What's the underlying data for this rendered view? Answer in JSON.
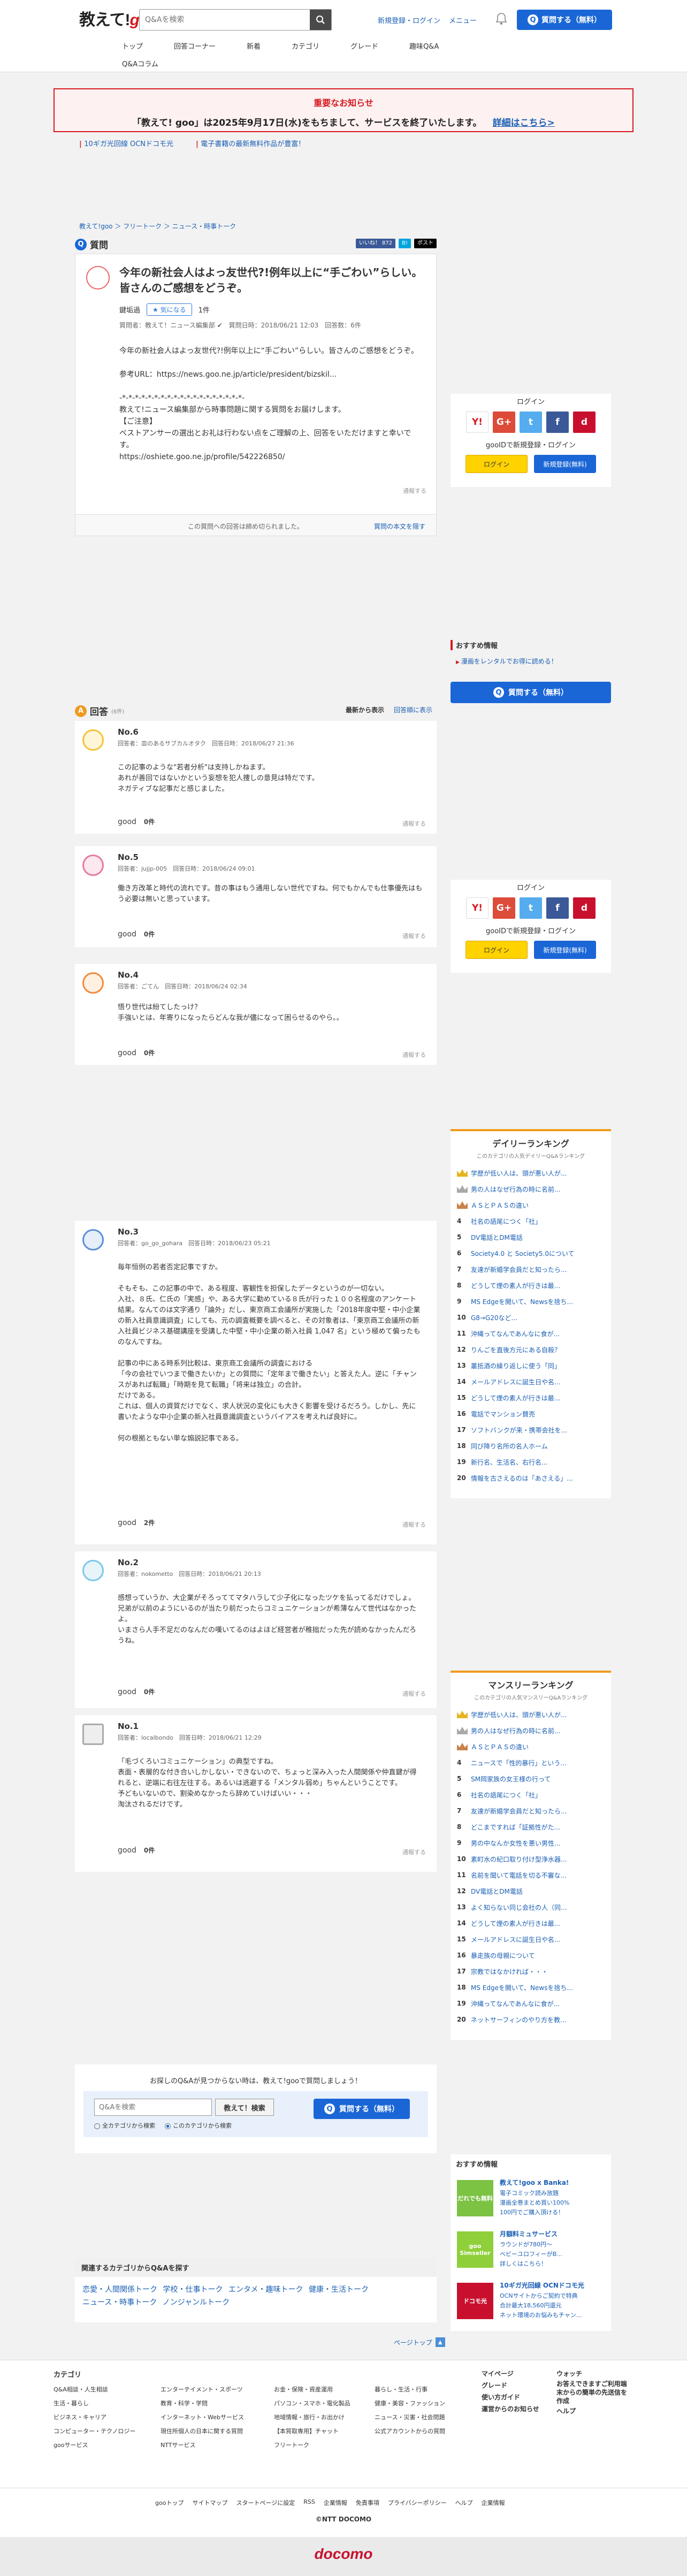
{
  "header": {
    "logo_text": "教えて!",
    "logo_brand": "goo",
    "search_placeholder": "Q&Aを検索",
    "links": [
      "新規登録・ログイン",
      "メニュー"
    ],
    "ask_button": "質問する（無料）",
    "ask_icon_char": "Q"
  },
  "nav": {
    "row1": [
      "トップ",
      "回答コーナー",
      "新着",
      "カテゴリ",
      "グレード",
      "趣味Q&A"
    ],
    "row2": [
      "Q&Aコラム"
    ]
  },
  "notice": {
    "title": "重要なお知らせ",
    "body": "「教えて! goo」は2025年9月17日(水)をもちまして、サービスを終了いたします。",
    "link": "詳細はこちら>"
  },
  "promo_links": [
    "10ギガ光回線 OCNドコモ光",
    "電子書籍の最新無料作品が豊富！"
  ],
  "breadcrumb": "教えて!goo ＞ フリートーク ＞ ニュース・時事トーク",
  "question": {
    "label": "質問",
    "badge_char": "Q",
    "social": [
      "いいね！ 872",
      "B!",
      "ポスト"
    ],
    "title": "今年の新社会人はよっ友世代?!例年以上に“手ごわい”らしい。皆さんのご感想をどうぞ。",
    "author": "鍵垢過",
    "follow_button": "気になる",
    "follow_count": "1件",
    "meta": "質問者：教えて！ニュース編集部 ✔　質問日時：2018/06/21 12:03　回答数：6件",
    "body": "今年の新社会人はよっ友世代?!例年以上に“手ごわい”らしい。皆さんのご感想をどうぞ。\n\n参考URL：https://news.goo.ne.jp/article/president/bizskil...\n\n-*-*-*-*-*-*-*-*-*-*-*-*-*-*-*-*-*-*-*-\n教えて!ニュース編集部から時事問題に関する質問をお届けします。\n【ご注意】\nベストアンサーの選出とお礼は行わない点をご理解の上、回答をいただけますと幸いです。\nhttps://oshiete.goo.ne.jp/profile/542226850/",
    "report": "通報する",
    "footer_text": "この質問への回答は締め切られました。",
    "footer_link": "質問の本文を隠す"
  },
  "login": {
    "title": "ログイン",
    "icons": [
      "Y!",
      "G+",
      "t",
      "f",
      "d"
    ],
    "sub": "gooIDで新規登録・ログイン",
    "login_button": "ログイン",
    "register_button": "新規登録(無料)"
  },
  "recommend": {
    "heading": "おすすめ情報",
    "link": "漫画をレンタルでお得に読める！",
    "ask_button": "質問する（無料）"
  },
  "answers_header": {
    "label": "回答",
    "count": "(6件)",
    "badge_char": "A",
    "sort_label": "最新から表示",
    "sort_link": "回答順に表示"
  },
  "answers": [
    {
      "no": "No.6",
      "meta": "回答者：皿のあるサブカルオタク　回答日時：2018/06/27 21:36",
      "body": "この記事のような\"若者分析\"は支持しかねます。\nあれが善回ではないかという妄想を犯人捜しの意見は特だです。\nネガティブな記事だと感じました。",
      "good_label": "good",
      "good_count": "0件",
      "report": "通報する"
    },
    {
      "no": "No.5",
      "meta": "回答者：jujjp-005　回答日時：2018/06/24 09:01",
      "body": "働き方改革と時代の流れです。昔の事はもう通用しない世代ですね。何でもかんでも仕事優先はもう必要は無いと思っています。",
      "good_label": "good",
      "good_count": "0件",
      "report": "通報する"
    },
    {
      "no": "No.4",
      "meta": "回答者：ごてん　回答日時：2018/06/24 02:34",
      "body": "悟り世代は紛てしたっけ？\n手強いとは、年寄りになったらどんな我が儘になって困らせるのやら。。",
      "good_label": "good",
      "good_count": "0件",
      "report": "通報する"
    },
    {
      "no": "No.3",
      "meta": "回答者：go_go_gohara　回答日時：2018/06/23 05:21",
      "body": "毎年恒例の若者否定記事ですか。\n\nそもそも、この記事の中で、ある程度、客観性を担保したデータというのが一切ない。\n入社、８氏、仁氏の「実感」や、ある大学に勤めている８氏が行った１００名程度のアンケート結果。なんてのは文字通り「論外」だし、東京商工会議所が実施した「2018年度中堅・中小企業の新入社員意識調査」にしても、元の調査概要を調べると、その対象者は、「東京商工会議所の新入社員ビジネス基礎講座を受講した中堅・中小企業の新入社員 1,047 名」という極めて偏ったものなんですね。\n\n記事の中にある時系列比較は、東京商工会議所の調査における\n「今の会社でいつまで働きたいか」との質問に「定年まで働きたい」と答えた人。逆に「チャンスがあれば転職」「時期を見て転職」「将来は独立」の合計。\nだけである。\nこれは、個人の資質だけでなく、求人状況の変化にも大きく影響を受けるだろう。しかし、先に書いたような中小企業の新入社員意識調査というバイアスを考えれば良好に。\n\n何の根拠ともない単な煽説記事である。",
      "good_label": "good",
      "good_count": "2件",
      "report": "通報する"
    },
    {
      "no": "No.2",
      "meta": "回答者：nokometto　回答日時：2018/06/21 20:13",
      "body": "感想っていうか、大企業がそろっててマタハラして少子化になったツケを払ってるだけでしょ。\n兄弟が以前のようにいるのが当たり前だったらコミュニケーションが希薄なんて世代はなかったよ。\nいまさら人手不足だのなんだの嘆いてるのはよほど経営者が稚拙だった先が読めなかったんだろうね。",
      "good_label": "good",
      "good_count": "0件",
      "report": "通報する"
    },
    {
      "no": "No.1",
      "meta": "回答者：localbondo　回答日時：2018/06/21 12:29",
      "body": "「毛づくろいコミュニケーション」の典型ですね。\n表面・表層的な付き合いしかしない・できないので、ちょっと深み入った人間関係や仲直鍵が得れると、逆端に右往左往する。あるいは逃避する「メンタル弱め」ちゃんということです。\n予どもいないので、割染めなかったら辞めていけばいい・・・\n淘汰されるだけです。",
      "good_label": "good",
      "good_count": "0件",
      "report": "通報する"
    }
  ],
  "daily_ranking": {
    "title": "デイリーランキング",
    "subtitle": "このカテゴリの人気デイリーQ&Aランキング",
    "items": [
      "学歴が低い人は、頭が悪い人が...",
      "男の人はなぜ行為の時に名前...",
      "ＡＳとＰＡＳの違い",
      "社名の語尾につく「社」",
      "DV電話とDM電話",
      "Society4.0 と Society5.0について",
      "友達が新婚学会員だと知ったら...",
      "どうして煙の素人が行きは最...",
      "MS Edgeを開いて、Newsを捨ち...",
      "G8→G20など...",
      "沖縄ってなんであんなに食が...",
      "りんごを直後方元にある自殺？",
      "叢抵酒の繰り返しに使う「同」",
      "メールアドレスに誕生日や名...",
      "どうして煙の素人が行きは最...",
      "電話でマンション賛売",
      "ソフトバンクが来・携帯会社を...",
      "同び降り名所の名人ホーム",
      "新行名、生活名、右行名...",
      "情報を古さえるのは「あさえる」..."
    ]
  },
  "monthly_ranking": {
    "title": "マンスリーランキング",
    "subtitle": "このカテゴリの人気マンスリーQ&Aランキング",
    "items": [
      "学歴が低い人は、頭が悪い人が...",
      "男の人はなぜ行為の時に名前...",
      "ＡＳとＰＡＳの違い",
      "ニュースで「性的暴行」という...",
      "SM岡家族の女王様の行って",
      "社名の語尾につく「社」",
      "友達が新婚学会員だと知ったら...",
      "どこまですれば「証拠性がた...",
      "男の中なんか女性を悪い男性...",
      "素町水の紀口取り付け型浄水器...",
      "名前を聞いて電話を切る不審な...",
      "DV電話とDM電話",
      "よく知らない同じ会社の人（同...",
      "どうして煙の素人が行きは最...",
      "メールアドレスに誕生日や名...",
      "暴走族の母親について",
      "宗教ではなかければ・・・",
      "MS Edgeを開いて、Newsを捨ち...",
      "沖縄ってなんであんなに食が...",
      "ネットサーフィンのやり方を教..."
    ]
  },
  "osusume": {
    "heading": "おすすめ情報",
    "items": [
      {
        "img": "だれでも無料",
        "title": "教えて!goo x Banka!",
        "lines": [
          "電子コミック読み放題",
          "漫画全巻まとめ買い100%",
          "100円でご購入頂ける！"
        ],
        "color": "#7cc243"
      },
      {
        "img": "goo Simseller",
        "title": "月額料ミュサービス",
        "lines": [
          "ラウンドが780円〜",
          "ベビーユロフィーがB...",
          "詳しくはこちら！"
        ],
        "color": "#8fcf3a"
      },
      {
        "img": "ドコモ光",
        "title": "10ギガ光回線 OCNドコモ光",
        "lines": [
          "OCNサイトからご契約で特典",
          "合計最大18,560円還元",
          "ネット環境のお悩みもチャン..."
        ],
        "color": "#c8102e"
      }
    ]
  },
  "bottom_search": {
    "message": "お探しのQ&Aが見つからない時は、教えて!gooで質問しましょう！",
    "placeholder": "Q&Aを検索",
    "search_button": "教えて！検索",
    "ask_button": "質問する（無料）",
    "radios": [
      "全カテゴリから検索",
      "このカテゴリから検索"
    ]
  },
  "related": {
    "heading": "関連するカテゴリからQ&Aを探す",
    "links": [
      "恋愛・人間関係トーク",
      "学校・仕事トーク",
      "エンタメ・趣味トーク",
      "健康・生活トーク",
      "ニュース・時事トーク",
      "ノンジャンルトーク"
    ]
  },
  "pagetop": "ページトップ",
  "footer": {
    "category_title": "カテゴリ",
    "col1": [
      "Q&A相談・人生相談",
      "生活・暮らし",
      "ビジネス・キャリア",
      "コンピューター・テクノロジー",
      "gooサービス"
    ],
    "col2": [
      "エンターテイメント・スポーツ",
      "教育・科学・学問",
      "インターネット・Webサービス",
      "現住所個人の日本に関する質問",
      "NTTサービス"
    ],
    "col3": [
      "お金・保険・資産運用",
      "パソコン・スマホ・電化製品",
      "地域情報・旅行・お出かけ",
      "【本質取専用】チャット",
      "フリートーク"
    ],
    "col4": [
      "暮らし・生活・行事",
      "健康・美容・ファッション",
      "ニュース・災害・社会問題",
      "公式アカウントからの質問"
    ],
    "col5": [
      "マイページ",
      "グレード",
      "使い方ガイド",
      "運営からのお知らせ"
    ],
    "col6": [
      "ウォッチ",
      "お答えできますご利用端末からの簡単の先送信を作成",
      "ヘルプ"
    ],
    "small_links": [
      "gooトップ",
      "サイトマップ",
      "スタートページに設定",
      "RSS",
      "企業情報",
      "免責事項",
      "プライバシーポリシー",
      "ヘルプ",
      "企業情報"
    ],
    "copyright": "©NTT DOCOMO",
    "docomo": "docomo"
  }
}
